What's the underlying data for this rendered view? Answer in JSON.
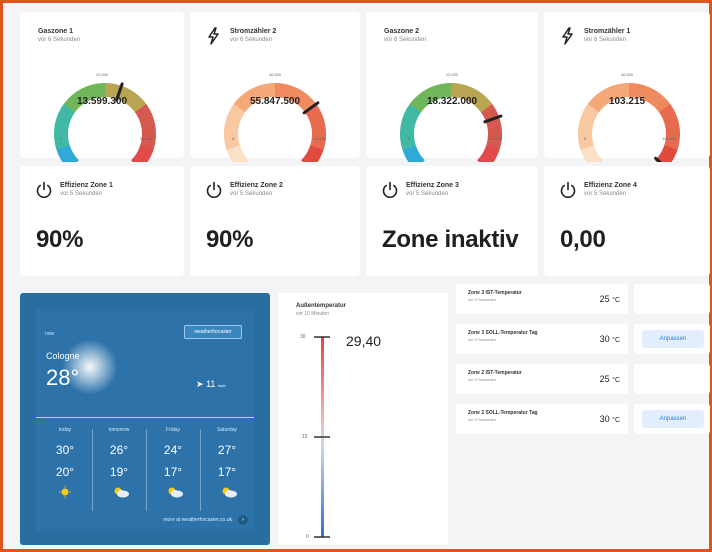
{
  "gauges": [
    {
      "title": "Gaszone 1",
      "sub": "vor 6 Sekunden",
      "value": "13.599.300",
      "top_label": "12.000",
      "min_label": "0",
      "max_label": "24.000",
      "level": 0.57,
      "scheme": "blue-green-red",
      "icon": null
    },
    {
      "title": "Stromzähler 2",
      "sub": "vor 6 Sekunden",
      "value": "55.847.500",
      "top_label": "40.000",
      "min_label": "0",
      "max_label": "80.000",
      "level": 0.7,
      "scheme": "peach-red",
      "icon": "bolt-icon"
    },
    {
      "title": "Gaszone 2",
      "sub": "vor 6 Sekunden",
      "value": "18.322.000",
      "top_label": "12.000",
      "min_label": "0",
      "max_label": "24.000",
      "level": 0.76,
      "scheme": "blue-green-red",
      "icon": null
    },
    {
      "title": "Stromzähler 1",
      "sub": "vor 6 Sekunden",
      "value": "103.215",
      "top_label": "40.000",
      "min_label": "0",
      "max_label": "100.000",
      "level": 0.99,
      "scheme": "peach-red",
      "icon": "bolt-icon"
    }
  ],
  "efficiency": [
    {
      "title": "Effizienz Zone 1",
      "sub": "vor 5 Sekunden",
      "value": "90%"
    },
    {
      "title": "Effizienz Zone 2",
      "sub": "vor 5 Sekunden",
      "value": "90%"
    },
    {
      "title": "Effizienz Zone 3",
      "sub": "vor 5 Sekunden",
      "value": "Zone inaktiv"
    },
    {
      "title": "Effizienz Zone 4",
      "sub": "vor 5 Sekunden",
      "value": "0,00"
    }
  ],
  "weather": {
    "now_label": "now",
    "provider": "weatherforcaster",
    "city": "Cologne",
    "temp": "28°",
    "wind": "11",
    "wind_unit": "mph",
    "forecast": [
      {
        "day": "today",
        "high": "30°",
        "low": "20°",
        "icon": "sun-icon"
      },
      {
        "day": "tomorrow",
        "high": "26°",
        "low": "19°",
        "icon": "partly-cloudy-icon"
      },
      {
        "day": "Friday",
        "high": "24°",
        "low": "17°",
        "icon": "partly-cloudy-icon"
      },
      {
        "day": "Saturday",
        "high": "27°",
        "low": "17°",
        "icon": "partly-cloudy-icon"
      }
    ],
    "footer": "more at weatherforcaster.co.uk",
    "footer_btn": "›"
  },
  "thermometer": {
    "title": "Außentemperatur",
    "sub": "vor 10 Minuten",
    "value": "29,40",
    "ticks": [
      "30",
      "15",
      "0"
    ],
    "min": 0,
    "max": 30,
    "level": 29.4
  },
  "zones": [
    {
      "name": "Zone 3 IST-Temperatur",
      "sub": "vor 5 Sekunden",
      "value": "25",
      "unit": "°C",
      "button": null
    },
    {
      "name": "Zone 3 SOLL-Temperatur Tag",
      "sub": "vor 5 Sekunden",
      "value": "30",
      "unit": "°C",
      "button": "Anpassen"
    },
    {
      "name": "Zone 2 IST-Temperatur",
      "sub": "vor 5 Sekunden",
      "value": "25",
      "unit": "°C",
      "button": null
    },
    {
      "name": "Zone 2 SOLL-Temperatur Tag",
      "sub": "vor 5 Sekunden",
      "value": "30",
      "unit": "°C",
      "button": "Anpassen"
    }
  ],
  "colors": {
    "frame": "#e2541d",
    "weather_bg": "#2a6da0",
    "button_text": "#2e7ad1",
    "needle": "#222222"
  }
}
